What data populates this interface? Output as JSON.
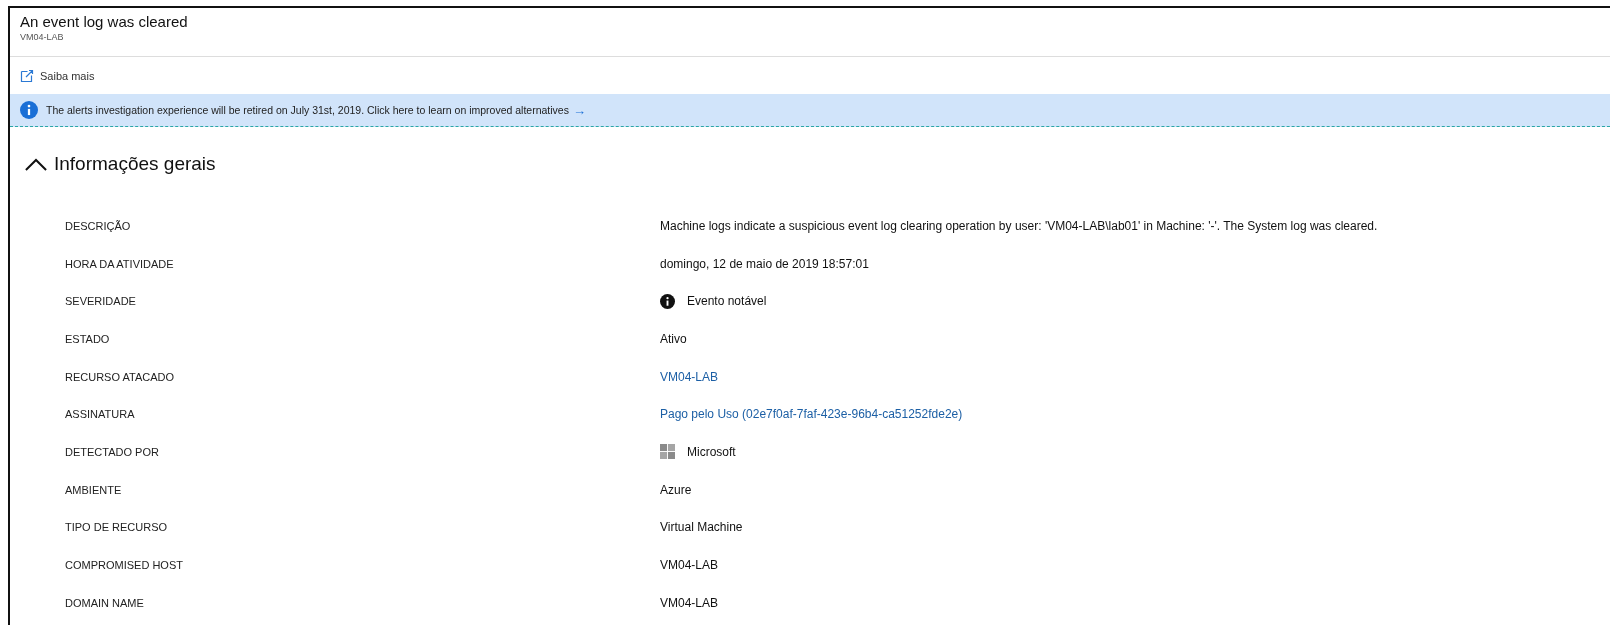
{
  "header": {
    "title": "An event log was cleared",
    "subtitle": "VM04-LAB"
  },
  "toolbar": {
    "learn_more": "Saiba mais"
  },
  "banner": {
    "text": "The alerts investigation experience will be retired on July 31st, 2019. Click here to learn on improved alternatives",
    "arrow": "→"
  },
  "section": {
    "title": "Informações gerais",
    "expanded": true
  },
  "fields": [
    {
      "label": "DESCRIÇÃO",
      "kind": "text",
      "value": "Machine logs indicate a suspicious event log clearing operation by user: 'VM04-LAB\\lab01' in Machine: '-'. The System log was cleared."
    },
    {
      "label": "HORA DA ATIVIDADE",
      "kind": "text",
      "value": "domingo, 12 de maio de 2019 18:57:01"
    },
    {
      "label": "SEVERIDADE",
      "kind": "severity",
      "value": "Evento notável"
    },
    {
      "label": "ESTADO",
      "kind": "text",
      "value": "Ativo"
    },
    {
      "label": "RECURSO ATACADO",
      "kind": "link",
      "value": "VM04-LAB"
    },
    {
      "label": "ASSINATURA",
      "kind": "link",
      "value": "Pago pelo Uso (02e7f0af-7faf-423e-96b4-ca51252fde2e)"
    },
    {
      "label": "DETECTADO POR",
      "kind": "provider",
      "value": "Microsoft"
    },
    {
      "label": "AMBIENTE",
      "kind": "text",
      "value": "Azure"
    },
    {
      "label": "TIPO DE RECURSO",
      "kind": "text",
      "value": "Virtual Machine"
    },
    {
      "label": "COMPROMISED HOST",
      "kind": "text",
      "value": "VM04-LAB"
    },
    {
      "label": "DOMAIN NAME",
      "kind": "text",
      "value": "VM04-LAB"
    }
  ]
}
